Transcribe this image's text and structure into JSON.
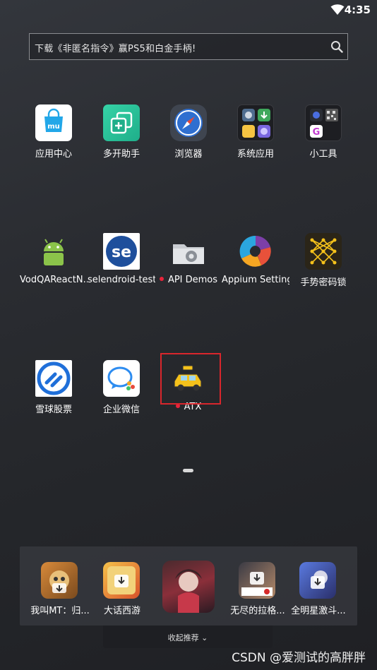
{
  "status_bar": {
    "time": "4:35"
  },
  "search": {
    "placeholder": "下载《非匿名指令》赢PS5和白金手柄!"
  },
  "apps": {
    "row1": [
      "应用中心",
      "多开助手",
      "浏览器",
      "系统应用",
      "小工具"
    ],
    "row2": [
      "VodQAReactN...",
      "selendroid-test...",
      "API Demos",
      "Appium Settings",
      "手势密码锁"
    ],
    "row3": [
      "雪球股票",
      "企业微信",
      "ATX"
    ]
  },
  "dock": {
    "items": [
      "我叫MT：归...",
      "大话西游",
      "无尽的拉格...",
      "全明星激斗..."
    ],
    "collapse_label": "收起推荐"
  },
  "watermark": "CSDN @爱测试的高胖胖",
  "colors": {
    "highlight": "#d9262c",
    "notification_dot": "#e8243b"
  }
}
